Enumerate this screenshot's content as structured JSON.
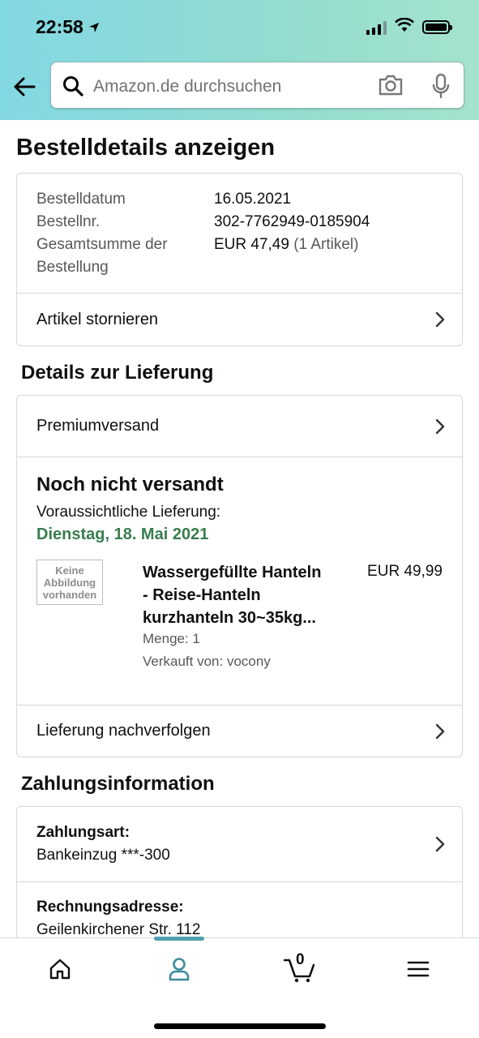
{
  "status": {
    "time": "22:58"
  },
  "search": {
    "placeholder": "Amazon.de durchsuchen"
  },
  "page": {
    "title": "Bestelldetails anzeigen"
  },
  "order": {
    "date_label": "Bestelldatum",
    "date_value": "16.05.2021",
    "number_label": "Bestellnr.",
    "number_value": "302-7762949-0185904",
    "total_label_1": "Gesamtsumme der",
    "total_label_2": "Bestellung",
    "total_value": "EUR 47,49",
    "total_count": "(1 Artikel)",
    "cancel_label": "Artikel stornieren"
  },
  "delivery": {
    "heading": "Details zur Lieferung",
    "shipping_method": "Premiumversand",
    "status": "Noch nicht versandt",
    "expected_label": "Voraussichtliche Lieferung:",
    "expected_date": "Dienstag, 18. Mai 2021",
    "no_image_text_1": "Keine",
    "no_image_text_2": "Abbildung",
    "no_image_text_3": "vorhanden",
    "item_title_1": "Wassergefüllte Hanteln",
    "item_title_2": "- Reise-Hanteln",
    "item_title_3": "kurzhanteln 30~35kg...",
    "item_price": "EUR 49,99",
    "quantity": "Menge: 1",
    "seller": "Verkauft von: vocony",
    "track_label": "Lieferung nachverfolgen"
  },
  "payment": {
    "heading": "Zahlungsinformation",
    "method_label": "Zahlungsart:",
    "method_value": "Bankeinzug ***-300",
    "billing_label": "Rechnungsadresse:",
    "billing_value": "Geilenkirchener Str. 112"
  },
  "tabbar": {
    "cart_count": "0",
    "items": [
      "home-icon",
      "account-icon",
      "cart-icon",
      "menu-icon"
    ]
  },
  "colors": {
    "accent_green": "#3a7d4e",
    "tab_indicator": "#4f9fb0"
  }
}
